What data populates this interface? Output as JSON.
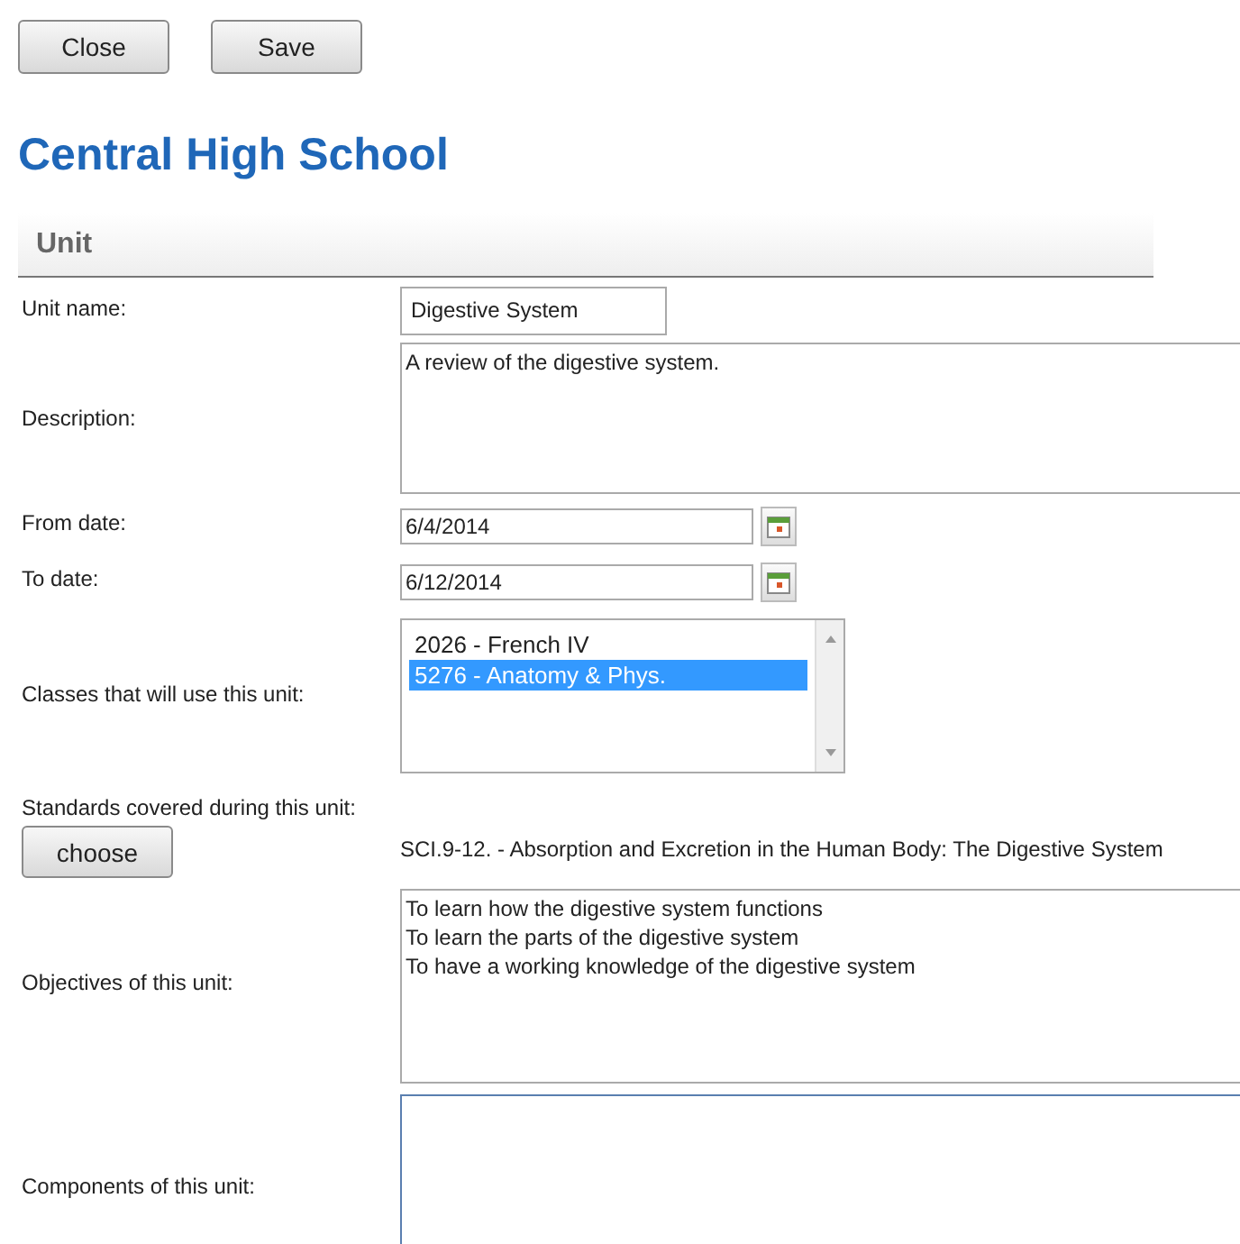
{
  "toolbar": {
    "buttons": [
      "Close",
      "Save"
    ]
  },
  "title": "Central High School",
  "section": {
    "header": "Unit"
  },
  "form": {
    "unit_name": {
      "label": "Unit name:",
      "value": "Digestive System"
    },
    "description": {
      "label": "Description:",
      "value": "A review of the digestive system."
    },
    "from_date": {
      "label": "From date:",
      "value": "6/4/2014"
    },
    "to_date": {
      "label": "To date:",
      "value": "6/12/2014"
    },
    "classes": {
      "label": "Classes that will use this unit:",
      "options": [
        {
          "label": "2026 - French IV",
          "selected": false
        },
        {
          "label": "5276 - Anatomy & Phys.",
          "selected": true
        }
      ]
    },
    "standards": {
      "label": "Standards covered during this unit:",
      "button": "choose",
      "value": "SCI.9-12. - Absorption and Excretion in the Human Body: The Digestive System"
    },
    "objectives": {
      "label": "Objectives of this unit:",
      "lines": [
        "To learn how the digestive system functions",
        "To learn the parts of the digestive system",
        "To have a working knowledge of the digestive system"
      ]
    },
    "components": {
      "label": "Components of this unit:",
      "focused": true
    }
  }
}
